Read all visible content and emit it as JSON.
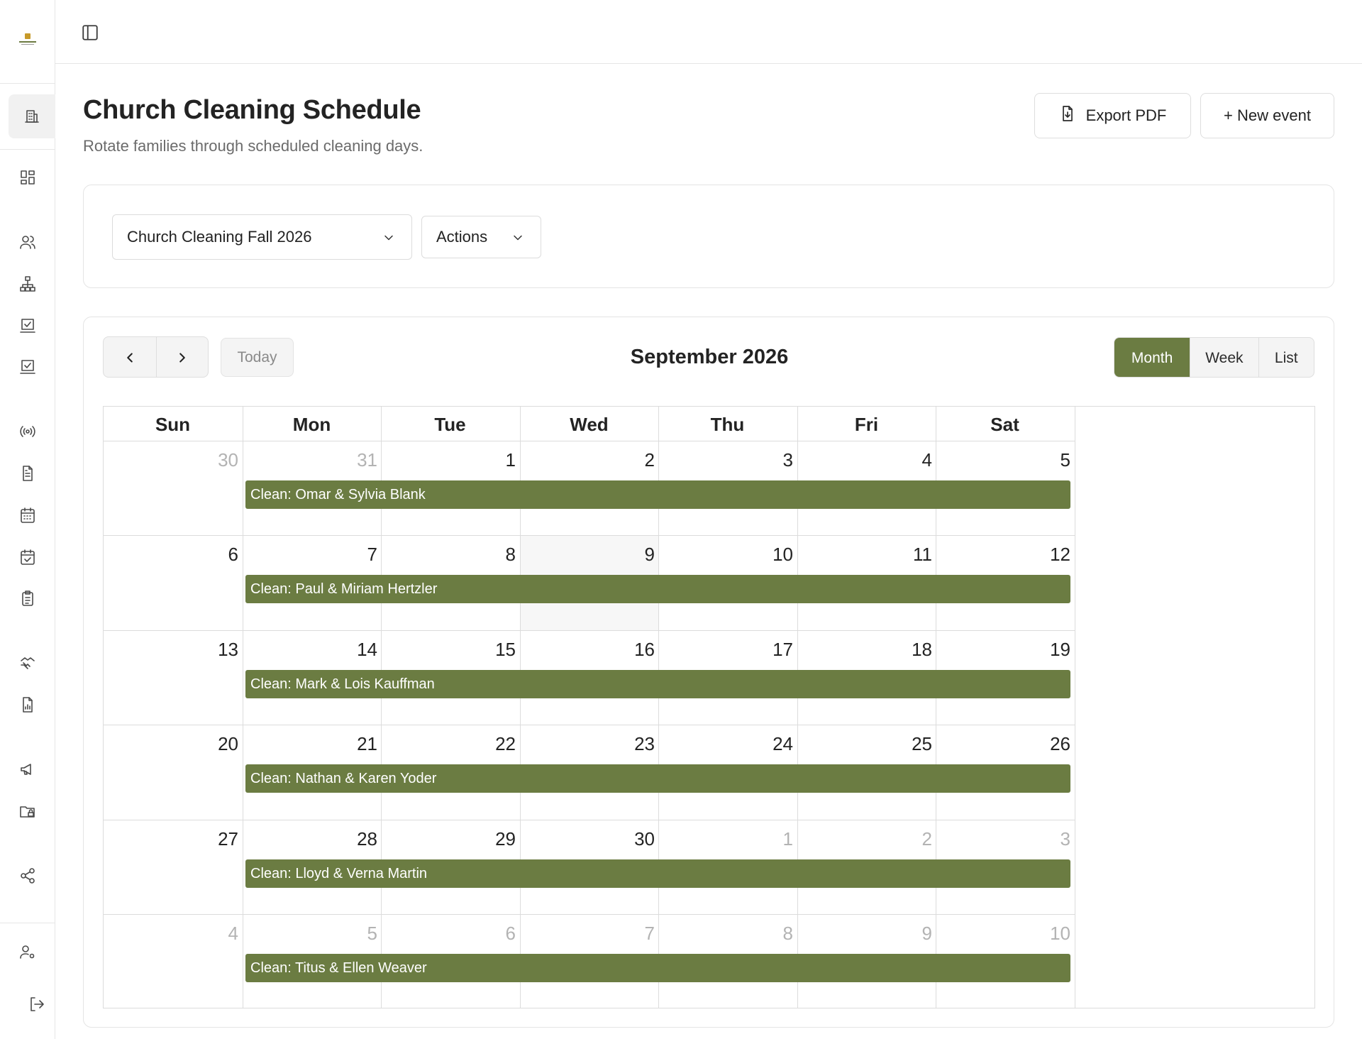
{
  "topbar": {
    "toggle_icon": "sidebar-toggle-icon"
  },
  "sidebar": {
    "icons": [
      "building-icon",
      "dashboard-icon",
      "users-icon",
      "org-chart-icon",
      "checklist-icon",
      "checklist-icon",
      "broadcast-icon",
      "document-icon",
      "calendar-icon",
      "calendar-check-icon",
      "clipboard-icon",
      "handshake-icon",
      "report-icon",
      "megaphone-icon",
      "folder-lock-icon",
      "share-icon",
      "user-settings-icon",
      "logout-icon"
    ]
  },
  "header": {
    "title": "Church Cleaning Schedule",
    "subtitle": "Rotate families through scheduled cleaning days.",
    "export_label": "Export PDF",
    "new_event_label": "+ New event"
  },
  "filters": {
    "schedule_selected": "Church Cleaning Fall 2026",
    "actions_label": "Actions"
  },
  "calendar": {
    "today_label": "Today",
    "title": "September 2026",
    "views": [
      "Month",
      "Week",
      "List"
    ],
    "active_view": "Month",
    "weekdays": [
      "Sun",
      "Mon",
      "Tue",
      "Wed",
      "Thu",
      "Fri",
      "Sat"
    ],
    "weeks": [
      {
        "days": [
          "30",
          "31",
          "1",
          "2",
          "3",
          "4",
          "5"
        ],
        "muted": [
          true,
          true,
          false,
          false,
          false,
          false,
          false
        ],
        "event": "Clean: Omar & Sylvia Blank"
      },
      {
        "days": [
          "6",
          "7",
          "8",
          "9",
          "10",
          "11",
          "12"
        ],
        "muted": [
          false,
          false,
          false,
          false,
          false,
          false,
          false
        ],
        "event": "Clean: Paul & Miriam Hertzler"
      },
      {
        "days": [
          "13",
          "14",
          "15",
          "16",
          "17",
          "18",
          "19"
        ],
        "muted": [
          false,
          false,
          false,
          false,
          false,
          false,
          false
        ],
        "event": "Clean: Mark & Lois Kauffman"
      },
      {
        "days": [
          "20",
          "21",
          "22",
          "23",
          "24",
          "25",
          "26"
        ],
        "muted": [
          false,
          false,
          false,
          false,
          false,
          false,
          false
        ],
        "event": "Clean: Nathan & Karen Yoder"
      },
      {
        "days": [
          "27",
          "28",
          "29",
          "30",
          "1",
          "2",
          "3"
        ],
        "muted": [
          false,
          false,
          false,
          false,
          true,
          true,
          true
        ],
        "event": "Clean: Lloyd & Verna Martin"
      },
      {
        "days": [
          "4",
          "5",
          "6",
          "7",
          "8",
          "9",
          "10"
        ],
        "muted": [
          true,
          true,
          true,
          true,
          true,
          true,
          true
        ],
        "event": "Clean: Titus & Ellen Weaver"
      }
    ],
    "event_color": "#6b7c42",
    "highlighted_day": "9"
  }
}
